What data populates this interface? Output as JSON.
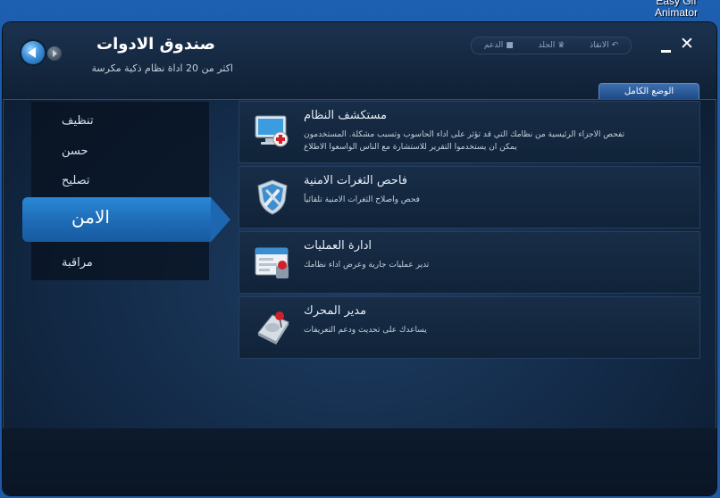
{
  "desktop": {
    "label_line1": "Easy Gif",
    "label_line2": "Animator"
  },
  "app": {
    "title": "صندوق الادوات",
    "subtitle": "اكثر من 20 اداة نظام ذكية مكرسة",
    "links": [
      {
        "label": "الدعم",
        "icon": "support-icon"
      },
      {
        "label": "الجلد",
        "icon": "skin-icon"
      },
      {
        "label": "الانقاذ",
        "icon": "rescue-icon"
      }
    ],
    "full_mode": "الوضع الكامل"
  },
  "sidebar": {
    "items": [
      {
        "label": "تنظيف"
      },
      {
        "label": "حسن"
      },
      {
        "label": "تصليح"
      },
      {
        "label": "الامن"
      },
      {
        "label": "مراقبة"
      }
    ],
    "active_index": 3
  },
  "tools": [
    {
      "name": "مستكشف النظام",
      "desc": "تفحص الاجزاء الرئيسية من نظامك التي قد تؤثر على اداء الحاسوب وتسبب مشكلة. المستخدمون يمكن ان يستخدموا التقرير للاستشارة مع الناس الواسعوا الاطلاع",
      "icon": "monitor-icon"
    },
    {
      "name": "فاحص الثغرات الامنية",
      "desc": "فحص واصلاح الثغرات الامنية تلقائياً",
      "icon": "shield-icon"
    },
    {
      "name": "ادارة العمليات",
      "desc": "تدير عمليات جارية وعرض اداء نظامك",
      "icon": "process-window-icon"
    },
    {
      "name": "مدير المحرك",
      "desc": "يساعدك على تحديث ودعم التعريفات",
      "icon": "disk-drive-icon"
    }
  ],
  "colors": {
    "accent": "#2a88d6",
    "window_bg": "#132a47",
    "desktop": "#1d5fb0"
  }
}
